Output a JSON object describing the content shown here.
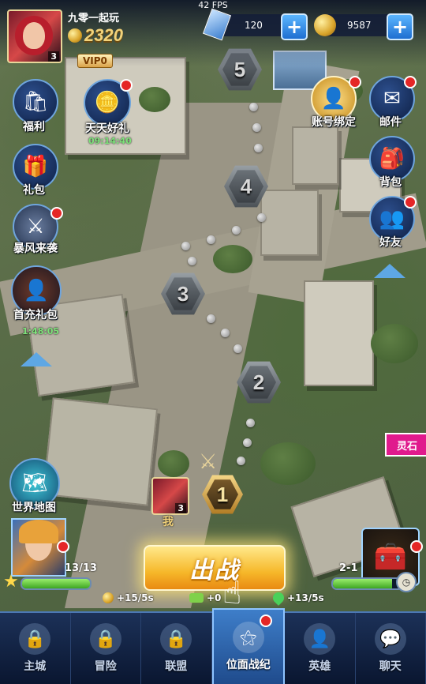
{
  "fps": "42 FPS",
  "player": {
    "name": "九零一起玩",
    "level": "3",
    "power": "2320",
    "vip": "VIP0"
  },
  "resources": {
    "gems": "120",
    "gold": "9587"
  },
  "left_icons": [
    {
      "label": "福利",
      "icon": "welfare-icon",
      "glyph": "🛍"
    },
    {
      "label": "天天好礼",
      "icon": "daily-gift-icon",
      "glyph": "🪙",
      "timer": "09:14:40"
    },
    {
      "label": "礼包",
      "icon": "gift-box-icon",
      "glyph": "🎁"
    },
    {
      "label": "暴风来袭",
      "icon": "storm-hero-icon",
      "glyph": "⚔"
    },
    {
      "label": "首充礼包",
      "icon": "first-recharge-icon",
      "glyph": "👤",
      "timer": "1:48:05"
    },
    {
      "label": "世界地图",
      "icon": "world-map-icon",
      "glyph": "🗺"
    }
  ],
  "right_icons": [
    {
      "label": "账号绑定",
      "icon": "account-bind-icon",
      "glyph": "👤"
    },
    {
      "label": "邮件",
      "icon": "mail-icon",
      "glyph": "✉"
    },
    {
      "label": "背包",
      "icon": "backpack-icon",
      "glyph": "🎒"
    },
    {
      "label": "好友",
      "icon": "friends-icon",
      "glyph": "👥"
    }
  ],
  "stages": [
    "1",
    "2",
    "3",
    "4",
    "5"
  ],
  "me_label": "我",
  "me_level": "3",
  "lingshi": "灵石",
  "hero_progress": {
    "text": "13/13",
    "value": 1.0
  },
  "chest_progress": {
    "text": "2-1",
    "value": 0.85
  },
  "fight_button": "出战",
  "rates": {
    "gold": "+15/5s",
    "exp": "+0",
    "energy": "+13/5s"
  },
  "tabs": [
    {
      "label": "主城",
      "icon": "lock-icon",
      "glyph": "🔒",
      "active": false
    },
    {
      "label": "冒险",
      "icon": "lock-icon",
      "glyph": "🔒",
      "active": false
    },
    {
      "label": "联盟",
      "icon": "lock-icon",
      "glyph": "🔒",
      "active": false
    },
    {
      "label": "位面战纪",
      "icon": "plane-war-icon",
      "glyph": "⚝",
      "active": true
    },
    {
      "label": "英雄",
      "icon": "hero-icon",
      "glyph": "👤",
      "active": false
    },
    {
      "label": "聊天",
      "icon": "chat-icon",
      "glyph": "💬",
      "active": false
    }
  ],
  "colors": {
    "accent": "#1e6ed1",
    "gold": "#f2d27a",
    "lingshi": "#e01a8d",
    "highlight": "#f6b82a"
  }
}
